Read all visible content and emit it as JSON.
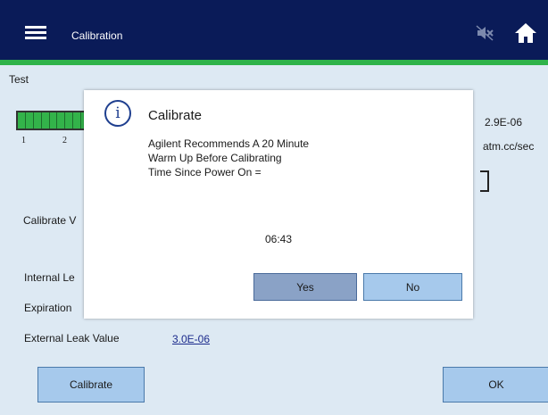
{
  "header": {
    "title": "Calibration",
    "menu_icon": "hamburger-menu-icon",
    "mute_icon": "speaker-muted-icon",
    "home_icon": "home-icon",
    "background_color": "#0a1b58",
    "accent_color": "#2fb34a"
  },
  "tab": {
    "label": "Test"
  },
  "bargraph": {
    "scale_left": "1",
    "scale_right": "2",
    "color": "#33b34a"
  },
  "reading": {
    "value": "2.9E-06",
    "units": "atm.cc/sec"
  },
  "fields": {
    "calibrate_value_label": "Calibrate V",
    "internal_leak_label": "Internal Le",
    "expiration_label": "Expiration",
    "external_leak_label": "External Leak Value",
    "external_leak_value": "3.0E-06"
  },
  "buttons": {
    "calibrate": "Calibrate",
    "ok": "OK"
  },
  "dialog": {
    "icon": "info-icon",
    "icon_glyph": "i",
    "title": "Calibrate",
    "message_lines": [
      "Agilent Recommends A 20 Minute",
      "Warm Up Before Calibrating",
      "Time Since Power On ="
    ],
    "time_value": "06:43",
    "yes_label": "Yes",
    "no_label": "No"
  }
}
